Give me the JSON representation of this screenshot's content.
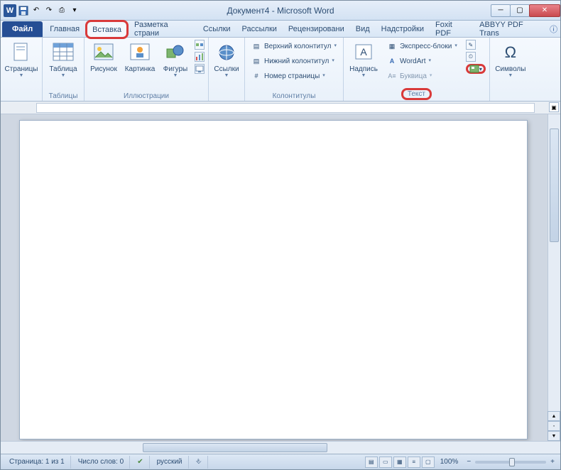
{
  "titlebar": {
    "title": "Документ4 - Microsoft Word",
    "word_glyph": "W"
  },
  "tabs": {
    "file": "Файл",
    "list": [
      "Главная",
      "Вставка",
      "Разметка страни",
      "Ссылки",
      "Рассылки",
      "Рецензировани",
      "Вид",
      "Надстройки",
      "Foxit PDF",
      "ABBYY PDF Trans"
    ],
    "active_idx": 1,
    "highlight_idx": 1
  },
  "ribbon": {
    "pages_group": "Страницы",
    "table_group": "Таблицы",
    "table_btn": "Таблица",
    "illus_group": "Иллюстрации",
    "illus": {
      "pic": "Рисунок",
      "clip": "Картинка",
      "shapes": "Фигуры"
    },
    "links_group": "Ссылки",
    "links_btn": "Ссылки",
    "hf_group": "Колонтитулы",
    "hf": {
      "header": "Верхний колонтитул",
      "footer": "Нижний колонтитул",
      "pagenum": "Номер страницы"
    },
    "text_group": "Текст",
    "text": {
      "box": "Надпись",
      "quick": "Экспресс-блоки",
      "wordart": "WordArt",
      "dropcap": "Буквица"
    },
    "sym_group": "Символы",
    "sym_btn": "Символы",
    "omega": "Ω"
  },
  "status": {
    "page": "Страница: 1 из 1",
    "words": "Число слов: 0",
    "lang": "русский",
    "zoom": "100%"
  }
}
